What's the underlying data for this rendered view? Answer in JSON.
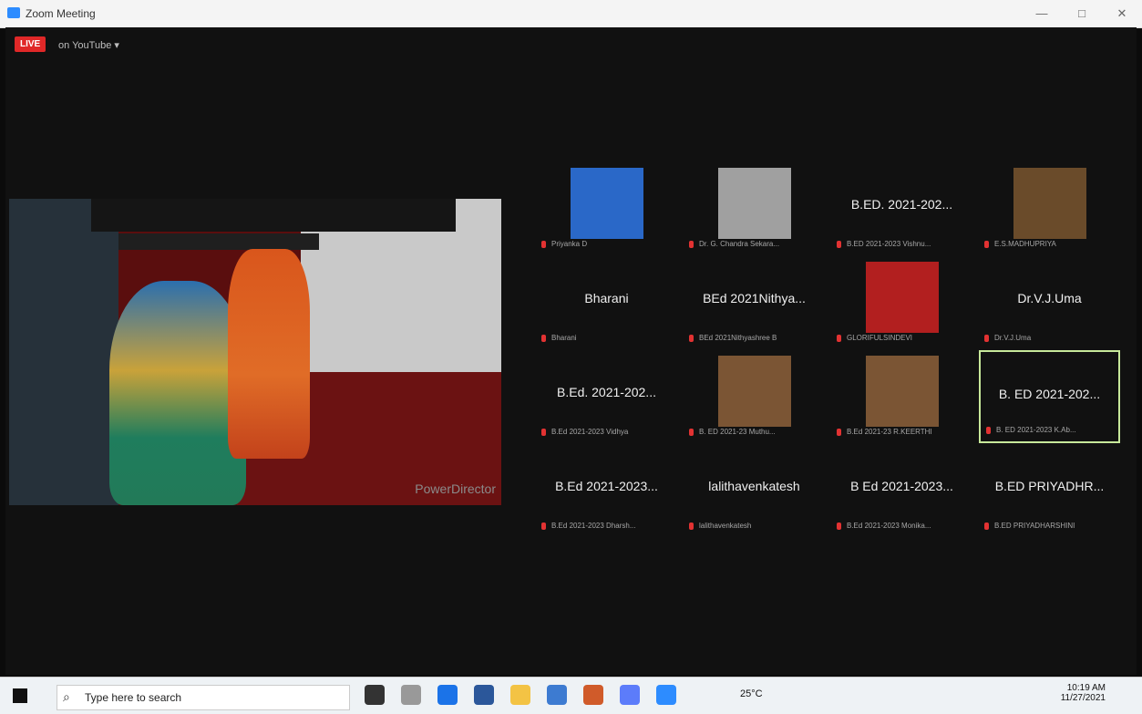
{
  "window": {
    "title": "Zoom Meeting"
  },
  "broadcast": {
    "badge": "LIVE",
    "text": "on YouTube ▾"
  },
  "share": {
    "watermark": "PowerDirector"
  },
  "tiles": [
    {
      "big": "",
      "small": "Priyanka D",
      "type": "photo",
      "color": "#2a68c8"
    },
    {
      "big": "",
      "small": "Dr. G. Chandra Sekara...",
      "type": "photo",
      "color": "#a0a0a0"
    },
    {
      "big": "B.ED. 2021-202...",
      "small": "B.ED 2021-2023 Vishnu...",
      "type": "name"
    },
    {
      "big": "",
      "small": "E.S.MADHUPRIYA",
      "type": "photo",
      "color": "#6a4b2a"
    },
    {
      "big": "Bharani",
      "small": "Bharani",
      "type": "name"
    },
    {
      "big": "BEd 2021Nithya...",
      "small": "BEd 2021Nithyashree B",
      "type": "name"
    },
    {
      "big": "",
      "small": "GLORIFULSINDEVI",
      "type": "photo",
      "color": "#b21f1f"
    },
    {
      "big": "Dr.V.J.Uma",
      "small": "Dr.V.J.Uma",
      "type": "name"
    },
    {
      "big": "B.Ed. 2021-202...",
      "small": "B.Ed 2021-2023 Vidhya",
      "type": "name"
    },
    {
      "big": "",
      "small": "B. ED 2021-23 Muthu...",
      "type": "photo",
      "color": "#7b5534"
    },
    {
      "big": "",
      "small": "B.Ed 2021-23 R.KEERTHI",
      "type": "photo",
      "color": "#7b5534"
    },
    {
      "big": "B. ED 2021-202...",
      "small": "B. ED 2021-2023 K.Ab...",
      "type": "name",
      "active": true
    },
    {
      "big": "B.Ed 2021-2023...",
      "small": "B.Ed 2021-2023 Dharsh...",
      "type": "name"
    },
    {
      "big": "lalithavenkatesh",
      "small": "lalithavenkatesh",
      "type": "name"
    },
    {
      "big": "B Ed 2021-2023...",
      "small": "B.Ed 2021-2023 Monika...",
      "type": "name"
    },
    {
      "big": "B.ED PRIYADHR...",
      "small": "B.ED PRIYADHARSHINI",
      "type": "name"
    }
  ],
  "taskbar": {
    "search_placeholder": "Type here to search",
    "weather": "25°C",
    "time": "10:19 AM",
    "date": "11/27/2021"
  }
}
